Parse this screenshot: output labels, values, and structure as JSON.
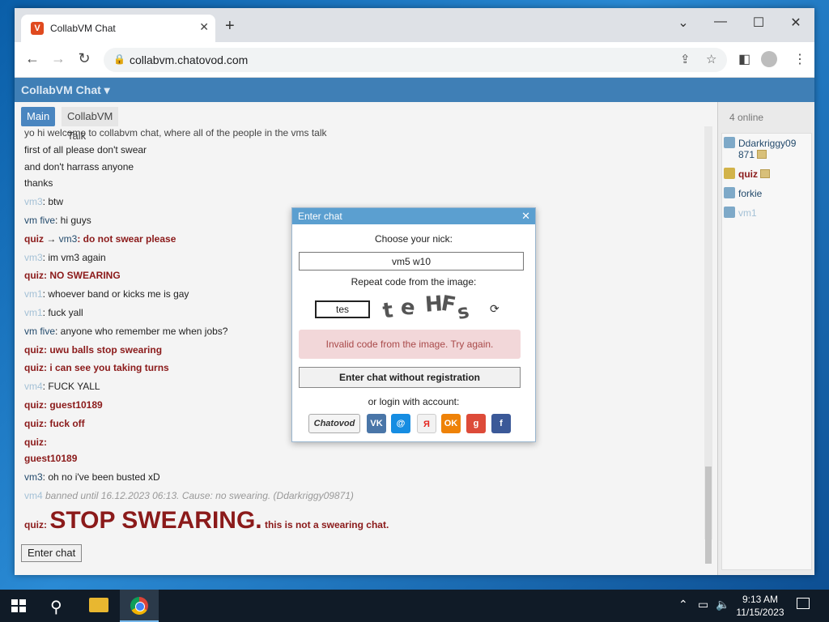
{
  "browser": {
    "tab_title": "CollabVM Chat",
    "url": "collabvm.chatovod.com"
  },
  "page": {
    "header_title": "CollabVM Chat ▾",
    "room_tabs": [
      "Main",
      "CollabVM Talk"
    ],
    "enter_chat_label": "Enter chat",
    "online_count": "4 online",
    "users": [
      {
        "line1": "Ddarkriggy09",
        "line2": "871"
      },
      {
        "name": "quiz"
      },
      {
        "name": "forkie"
      },
      {
        "name": "vm1"
      }
    ],
    "messages": {
      "m1": "yo hi welcome to collabvm chat, where all of the people in the vms talk",
      "m2": "first of all please don't swear",
      "m3": "and don't harrass anyone",
      "m4": "thanks",
      "m5_nick": "vm3",
      "m5_text": ": btw",
      "m6_nick": "vm five",
      "m6_text": ": hi guys",
      "m7_nick": "quiz",
      "m7_arrow": " → ",
      "m7_target": "vm3",
      "m7_text": ": do not swear please",
      "m8_nick": "vm3",
      "m8_text": ": im vm3 again",
      "m9_nick": "quiz",
      "m9_text": ": NO SWEARING",
      "m10_nick": "vm1",
      "m10_text": ": whoever band or kicks me is gay",
      "m11_nick": "vm1",
      "m11_text": ": fuck yall",
      "m12_nick": "vm five",
      "m12_text": ": anyone who remember me when jobs?",
      "m13_nick": "quiz",
      "m13_text": ": uwu balls stop swearing",
      "m14_nick": "quiz",
      "m14_text": ": i can see you taking turns",
      "m15_nick": "vm4",
      "m15_text": ": FUCK YALL",
      "m16_nick": "quiz",
      "m16_text": ": guest10189",
      "m17_nick": "quiz",
      "m17_text": ": fuck off",
      "m18_nick": "quiz",
      "m18_text": ":",
      "m19": "guest10189",
      "m20_nick": "vm3",
      "m20_text": ": oh no i've been busted xD",
      "m21_nick": "vm4",
      "m21_text": " banned until 16.12.2023 06:13. Cause: no swearing. (Ddarkriggy09871)",
      "m22_nick": "quiz",
      "m22_colon": ": ",
      "m22_big": "STOP SWEARING.",
      "m22_text": " this is not a swearing chat."
    }
  },
  "modal": {
    "title": "Enter chat",
    "choose_nick": "Choose your nick:",
    "nick_value": "vm5 w10",
    "repeat_code": "Repeat code from the image:",
    "code_value": "tes",
    "captcha_text": [
      "t",
      "e",
      "H",
      "F",
      "s"
    ],
    "error": "Invalid code from the image. Try again.",
    "enter_without_reg": "Enter chat without registration",
    "or_login": "or login with account:",
    "login_providers": [
      "Chatovod",
      "VK",
      "@",
      "Я",
      "OK",
      "g",
      "f"
    ]
  },
  "taskbar": {
    "time": "9:13 AM",
    "date": "11/15/2023"
  },
  "colors": {
    "header": "#3f7fb6",
    "modal_head": "#5b9fd0",
    "nick_red": "#8b1a1a",
    "error_bg": "#f2d7d9"
  },
  "icons": [
    "search-icon",
    "folder-icon",
    "chrome-icon",
    "windows-start-icon",
    "refresh-icon",
    "close-icon",
    "lock-icon",
    "star-icon",
    "share-icon",
    "sidebar-icon",
    "menu-icon",
    "profile-icon",
    "back-icon",
    "forward-icon",
    "reload-icon",
    "new-tab-icon",
    "minimize-icon",
    "maximize-icon",
    "chevron-down-icon",
    "notification-icon",
    "network-icon",
    "volume-icon",
    "chevron-up-icon"
  ]
}
